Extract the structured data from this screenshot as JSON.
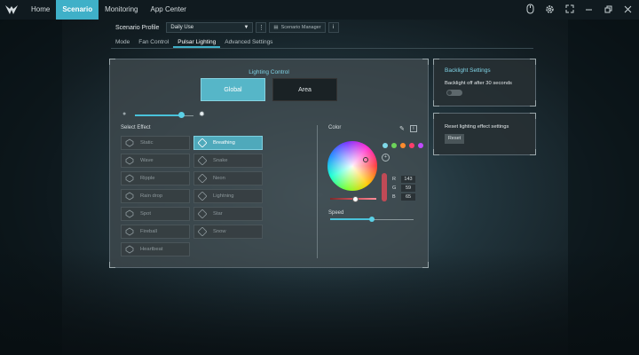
{
  "nav": {
    "items": [
      "Home",
      "Scenario",
      "Monitoring",
      "App Center"
    ],
    "active": "Scenario",
    "icons": [
      "mouse-icon",
      "gear-icon",
      "fullscreen-icon",
      "minimize-icon",
      "restore-icon",
      "close-icon"
    ]
  },
  "profile": {
    "label": "Scenario Profile",
    "selected": "Daily Use",
    "manager_label": "Scenario Manager"
  },
  "tabs": [
    "Mode",
    "Fan Control",
    "Pulsar Lighting",
    "Advanced Settings"
  ],
  "active_tab": "Pulsar Lighting",
  "lighting": {
    "title": "Lighting Control",
    "global_label": "Global",
    "area_label": "Area",
    "brightness": 0.8,
    "select_effect_title": "Select Effect",
    "effects": [
      "Static",
      "Breathing",
      "Wave",
      "Snake",
      "Ripple",
      "Neon",
      "Rain drop",
      "Lightning",
      "Spot",
      "Star",
      "Fireball",
      "Snow",
      "Heartbeat"
    ],
    "active_effect": "Breathing",
    "color_title": "Color",
    "swatches": [
      "#7fd9e8",
      "#6cd35a",
      "#ff8c2e",
      "#ff3d6b",
      "#c04bff"
    ],
    "rgb": {
      "r": "143",
      "g": "59",
      "b": "65"
    },
    "speed_title": "Speed",
    "speed": 0.5
  },
  "backlight": {
    "title": "Backlight Settings",
    "text": "Backlight off after 30 seconds",
    "enabled": false
  },
  "reset": {
    "text": "Reset lighting effect settings",
    "button": "Reset"
  },
  "colors": {
    "accent": "#3fb0c8"
  }
}
